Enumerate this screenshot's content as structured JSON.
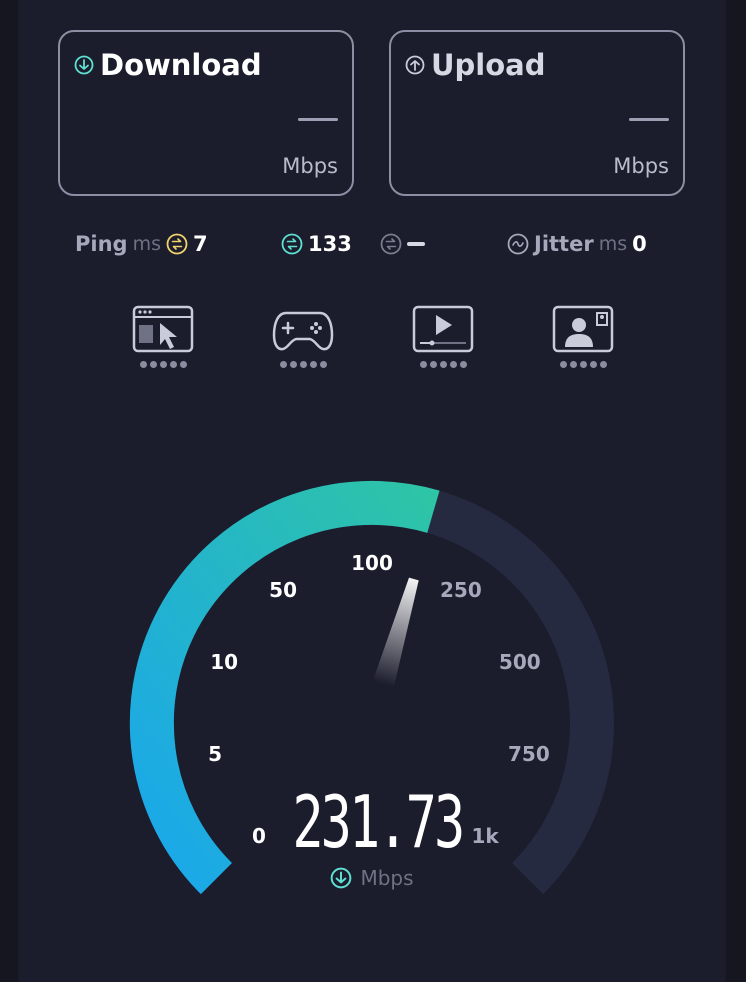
{
  "download": {
    "label": "Download",
    "value": "—",
    "unit": "Mbps"
  },
  "upload": {
    "label": "Upload",
    "value": "—",
    "unit": "Mbps"
  },
  "ping": {
    "label": "Ping",
    "unit": "ms",
    "idle": "7",
    "download": "133",
    "upload_dash": "—"
  },
  "jitter": {
    "label": "Jitter",
    "unit": "ms",
    "value": "0"
  },
  "quality_icons": [
    "browsing-icon",
    "gaming-icon",
    "streaming-icon",
    "video-call-icon"
  ],
  "gauge": {
    "ticks": [
      "0",
      "5",
      "10",
      "50",
      "100",
      "250",
      "500",
      "750",
      "1k"
    ],
    "reading": "231.73",
    "reading_unit": "Mbps",
    "fill_fraction": 0.56
  },
  "colors": {
    "accent_start": "#1aa7ec",
    "accent_end": "#2ec4a6",
    "idle_ping": "#f2d36b",
    "download_ping": "#5ee0d2",
    "track": "#262a40"
  }
}
